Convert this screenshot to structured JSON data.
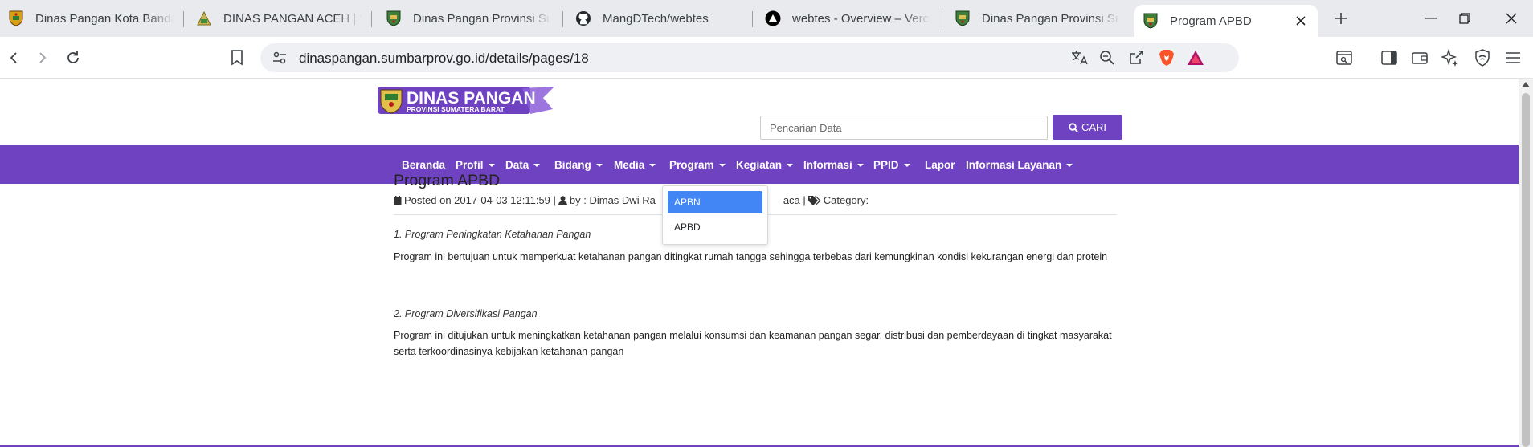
{
  "browser": {
    "tabs": [
      {
        "title": "Dinas Pangan Kota Bandar",
        "icon": "crest-icon"
      },
      {
        "title": "DINAS PANGAN ACEH | W",
        "icon": "aceh-crest-icon"
      },
      {
        "title": "Dinas Pangan Provinsi Sum",
        "icon": "crest-icon"
      },
      {
        "title": "MangDTech/webtes",
        "icon": "github-icon"
      },
      {
        "title": "webtes - Overview – Verce",
        "icon": "vercel-icon"
      },
      {
        "title": "Dinas Pangan Provinsi Sum",
        "icon": "crest-icon"
      },
      {
        "title": "Program APBD",
        "icon": "crest-icon",
        "active": true
      }
    ],
    "url": "dinaspangan.sumbarprov.go.id/details/pages/18",
    "notification_count": "1",
    "accent": "#6f42c1"
  },
  "site": {
    "logo_text": "DINAS PANGAN",
    "logo_subtext": "PROVINSI SUMATERA BARAT",
    "search_placeholder": "Pencarian Data",
    "search_button": "CARI",
    "nav": [
      {
        "label": "Beranda",
        "caret": false
      },
      {
        "label": "Profil",
        "caret": true
      },
      {
        "label": "Data",
        "caret": true
      },
      {
        "label": "Bidang",
        "caret": true
      },
      {
        "label": "Media",
        "caret": true
      },
      {
        "label": "Program",
        "caret": true
      },
      {
        "label": "Kegiatan",
        "caret": true
      },
      {
        "label": "Informasi",
        "caret": true
      },
      {
        "label": "PPID",
        "caret": true
      },
      {
        "label": "Lapor",
        "caret": false
      },
      {
        "label": "Informasi Layanan",
        "caret": true
      }
    ],
    "dropdown": [
      "APBN",
      "APBD"
    ]
  },
  "article": {
    "title": "Program APBD",
    "meta_posted": "Posted on 2017-04-03 12:11:59 |",
    "meta_by": "by : Dimas Dwi Ra",
    "meta_read": "aca |",
    "meta_category": "Category:",
    "sections": [
      {
        "heading": "1. Program Peningkatan Ketahanan Pangan",
        "body": "Program ini bertujuan untuk memperkuat ketahanan pangan ditingkat rumah tangga sehingga terbebas dari kemungkinan kondisi kekurangan energi dan protein"
      },
      {
        "heading": "2. Program Diversifikasi Pangan",
        "body": "Program ini ditujukan untuk meningkatkan ketahanan pangan melalui konsumsi dan keamanan pangan segar, distribusi dan pemberdayaan di tingkat masyarakat serta terkoordinasinya kebijakan ketahanan pangan"
      }
    ]
  }
}
